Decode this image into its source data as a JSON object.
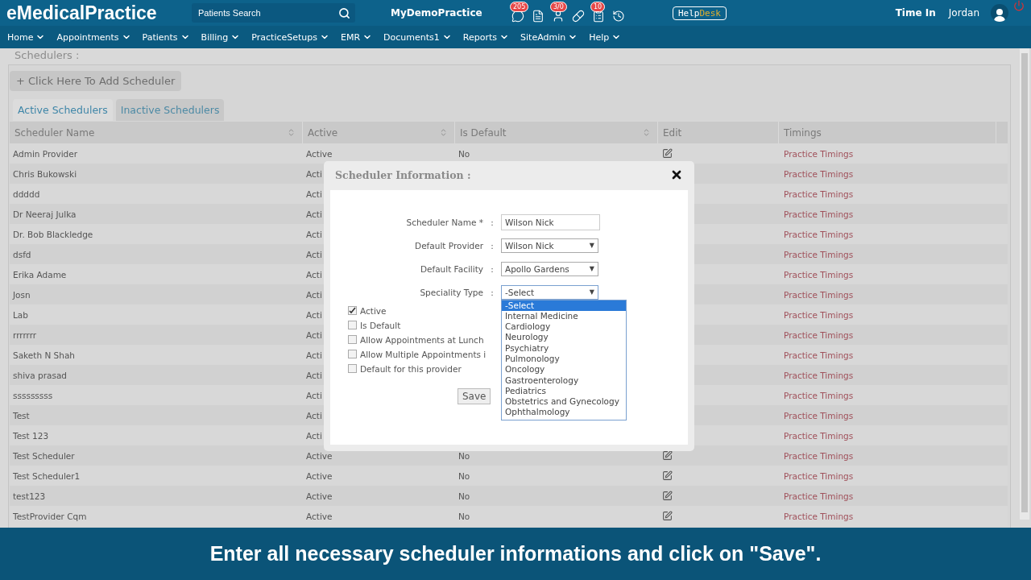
{
  "header": {
    "logo": "eMedicalPractice",
    "search": {
      "placeholder": "Patients Search"
    },
    "practice": "MyDemoPractice",
    "icons": [
      {
        "kind": "chat",
        "badge": "205"
      },
      {
        "kind": "document"
      },
      {
        "kind": "person",
        "badge": "3/0"
      },
      {
        "kind": "pill"
      },
      {
        "kind": "list",
        "badge": "10"
      },
      {
        "kind": "history"
      }
    ],
    "helpdesk": {
      "first": "Help",
      "second": "Desk"
    },
    "time_in": "Time In",
    "user": "Jordan"
  },
  "nav": [
    "Home",
    "Appointments",
    "Patients",
    "Billing",
    "PracticeSetups",
    "EMR",
    "Documents1",
    "Reports",
    "SiteAdmin",
    "Help"
  ],
  "page": {
    "title": "Schedulers  :",
    "add_button": "+ Click Here To Add Scheduler",
    "tabs": [
      {
        "label": "Active Schedulers",
        "selected": true
      },
      {
        "label": "Inactive Schedulers",
        "selected": false
      }
    ],
    "table": {
      "columns": [
        {
          "label": "Scheduler Name",
          "sortable": true
        },
        {
          "label": "Active",
          "sortable": true
        },
        {
          "label": "Is Default",
          "sortable": true
        },
        {
          "label": "Edit",
          "sortable": false
        },
        {
          "label": "Timings",
          "sortable": false
        }
      ],
      "rows": [
        {
          "name": "Admin Provider",
          "active": "Active",
          "is_default": "No",
          "edit": true,
          "timings": "Practice Timings"
        },
        {
          "name": "Chris Bukowski",
          "active": "Acti",
          "timings": "Practice Timings"
        },
        {
          "name": "ddddd",
          "active": "Acti",
          "timings": "Practice Timings"
        },
        {
          "name": "Dr Neeraj Julka",
          "active": "Acti",
          "timings": "Practice Timings"
        },
        {
          "name": "Dr. Bob Blackledge",
          "active": "Acti",
          "timings": "Practice Timings"
        },
        {
          "name": "dsfd",
          "active": "Acti",
          "timings": "Practice Timings"
        },
        {
          "name": "Erika Adame",
          "active": "Acti",
          "timings": "Practice Timings"
        },
        {
          "name": "Josn",
          "active": "Acti",
          "timings": "Practice Timings"
        },
        {
          "name": "Lab",
          "active": "Acti",
          "timings": "Practice Timings"
        },
        {
          "name": "rrrrrrr",
          "active": "Acti",
          "timings": "Practice Timings"
        },
        {
          "name": "Saketh N Shah",
          "active": "Acti",
          "timings": "Practice Timings"
        },
        {
          "name": "shiva prasad",
          "active": "Acti",
          "timings": "Practice Timings"
        },
        {
          "name": "sssssssss",
          "active": "Acti",
          "timings": "Practice Timings"
        },
        {
          "name": "Test",
          "active": "Acti",
          "timings": "Practice Timings"
        },
        {
          "name": "Test 123",
          "active": "Acti",
          "timings": "Practice Timings"
        },
        {
          "name": "Test Scheduler",
          "active": "Active",
          "is_default": "No",
          "edit": true,
          "timings": "Practice Timings"
        },
        {
          "name": "Test Scheduler1",
          "active": "Active",
          "is_default": "No",
          "edit": true,
          "timings": "Practice Timings"
        },
        {
          "name": "test123",
          "active": "Active",
          "is_default": "No",
          "edit": true,
          "timings": "Practice Timings"
        },
        {
          "name": "TestProvider Cqm",
          "active": "Active",
          "is_default": "No",
          "edit": true,
          "timings": "Practice Timings"
        }
      ]
    }
  },
  "modal": {
    "title": "Scheduler  Information :",
    "fields": [
      {
        "kind": "text",
        "label": "Scheduler Name *",
        "colon": ":",
        "value": "Wilson Nick"
      },
      {
        "kind": "select",
        "label": "Default Provider",
        "colon": ":",
        "value": "Wilson Nick",
        "caret": "▼",
        "expanded": false
      },
      {
        "kind": "select",
        "label": "Default Facility",
        "colon": ":",
        "value": "Apollo Gardens",
        "caret": "▼",
        "expanded": false
      },
      {
        "kind": "select",
        "label": "Speciality Type",
        "colon": ":",
        "value": "-Select",
        "caret": "▼",
        "expanded": true,
        "options": [
          {
            "label": "-Select",
            "selected": true
          },
          {
            "label": "Internal Medicine",
            "selected": false
          },
          {
            "label": "Cardiology",
            "selected": false
          },
          {
            "label": "Neurology",
            "selected": false
          },
          {
            "label": "Psychiatry",
            "selected": false
          },
          {
            "label": "Pulmonology",
            "selected": false
          },
          {
            "label": "Oncology",
            "selected": false
          },
          {
            "label": "Gastroenterology",
            "selected": false
          },
          {
            "label": "Pediatrics",
            "selected": false
          },
          {
            "label": "Obstetrics and Gynecology",
            "selected": false
          },
          {
            "label": "Ophthalmology",
            "selected": false
          }
        ]
      }
    ],
    "checkboxes": [
      {
        "label": "Active",
        "checked": true
      },
      {
        "label": "Is Default",
        "checked": false
      },
      {
        "label": "Allow Appointments at Lunch",
        "checked": false
      },
      {
        "label": "Allow Multiple Appointments i",
        "checked": false
      },
      {
        "label": "Default for this provider",
        "checked": false
      }
    ],
    "save": "Save"
  },
  "caption": "Enter all necessary scheduler informations and click on \"Save\"."
}
